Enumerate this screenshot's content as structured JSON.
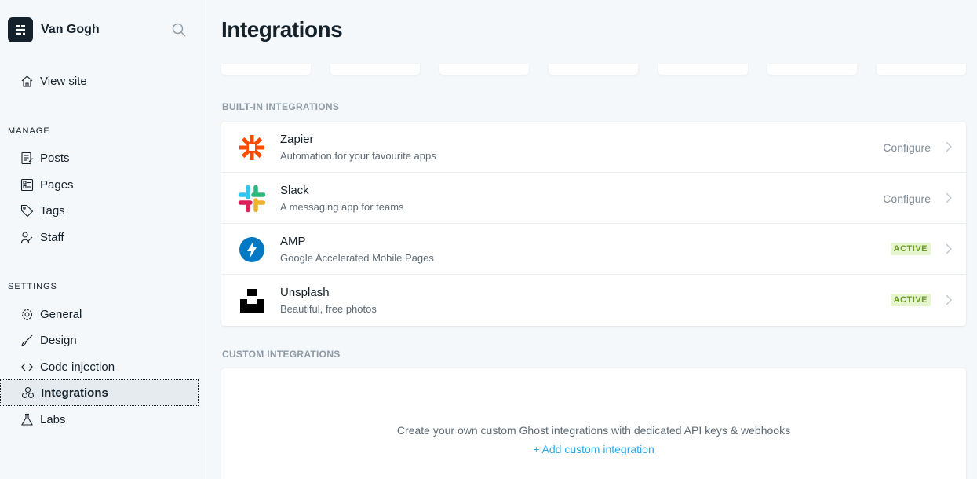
{
  "sidebar": {
    "site_name": "Van Gogh",
    "view_site": "View site",
    "manage_label": "MANAGE",
    "manage_items": [
      {
        "label": "Posts",
        "icon": "posts-icon"
      },
      {
        "label": "Pages",
        "icon": "pages-icon"
      },
      {
        "label": "Tags",
        "icon": "tag-icon"
      },
      {
        "label": "Staff",
        "icon": "staff-icon"
      }
    ],
    "settings_label": "SETTINGS",
    "settings_items": [
      {
        "label": "General",
        "icon": "gear-icon"
      },
      {
        "label": "Design",
        "icon": "brush-icon"
      },
      {
        "label": "Code injection",
        "icon": "code-icon"
      },
      {
        "label": "Integrations",
        "icon": "integrations-icon",
        "active": true
      },
      {
        "label": "Labs",
        "icon": "flask-icon"
      }
    ]
  },
  "main": {
    "title": "Integrations",
    "built_in_label": "BUILT-IN INTEGRATIONS",
    "integrations": [
      {
        "name": "Zapier",
        "desc": "Automation for your favourite apps",
        "action": "Configure"
      },
      {
        "name": "Slack",
        "desc": "A messaging app for teams",
        "action": "Configure"
      },
      {
        "name": "AMP",
        "desc": "Google Accelerated Mobile Pages",
        "status": "ACTIVE"
      },
      {
        "name": "Unsplash",
        "desc": "Beautiful, free photos",
        "status": "ACTIVE"
      }
    ],
    "custom_label": "CUSTOM INTEGRATIONS",
    "custom_text": "Create your own custom Ghost integrations with dedicated API keys & webhooks",
    "add_custom": "Add custom integration"
  },
  "colors": {
    "accent": "#2aa7e8",
    "active_badge": "#e6f5cf",
    "zapier": "#ff4a00",
    "amp": "#0379c4"
  }
}
